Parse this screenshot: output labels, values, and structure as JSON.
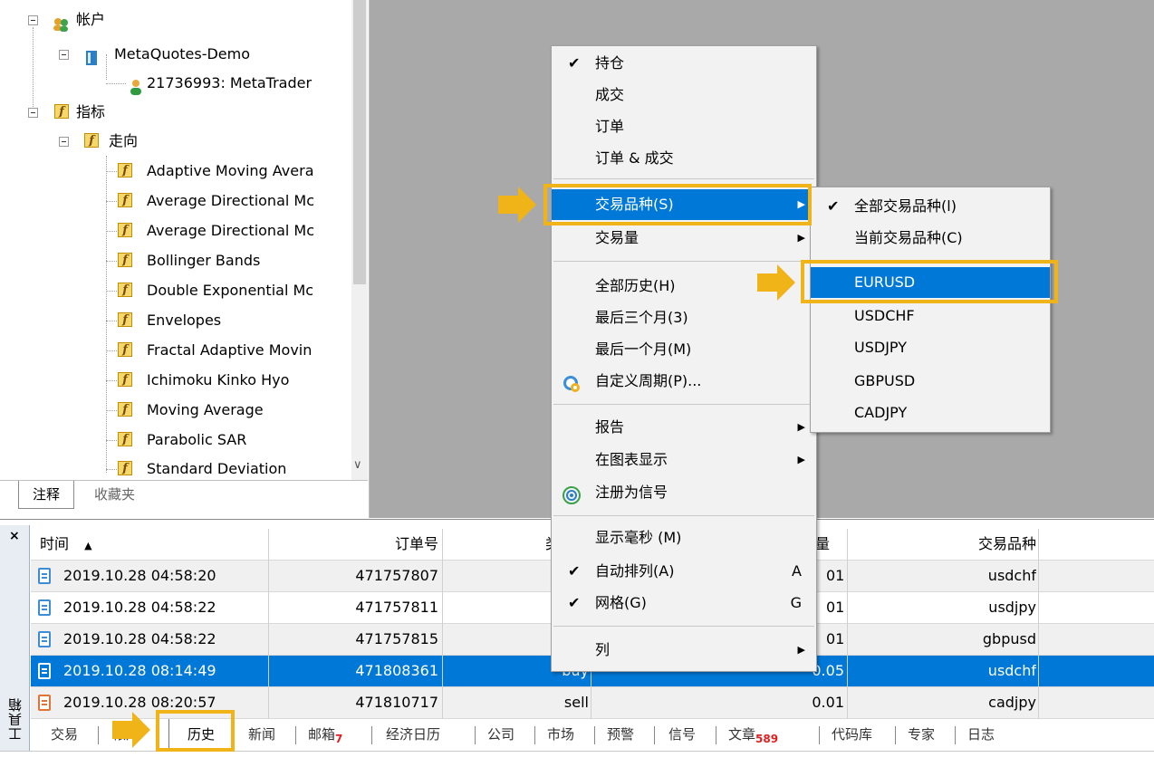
{
  "navigator": {
    "accounts_label": "帐户",
    "server_label": "MetaQuotes-Demo",
    "account_label": "21736993: MetaTrader",
    "indicators_label": "指标",
    "trend_label": "走向",
    "trend_items": [
      "Adaptive Moving Avera",
      "Average Directional Mc",
      "Average Directional Mc",
      "Bollinger Bands",
      "Double Exponential Mc",
      "Envelopes",
      "Fractal Adaptive Movin",
      "Ichimoku Kinko Hyo",
      "Moving Average",
      "Parabolic SAR",
      "Standard Deviation"
    ],
    "tabs": [
      "注释",
      "收藏夹"
    ],
    "scroll_down_glyph": "∨"
  },
  "toolbox": {
    "title": "工具箱",
    "close_glyph": "×",
    "columns": {
      "time": "时间",
      "sort_glyph": "▲",
      "order": "订单号",
      "type_partial": "类",
      "volume_partial": "量",
      "symbol": "交易品种"
    },
    "rows": [
      {
        "time": "2019.10.28 04:58:20",
        "order": "471757807",
        "type": "",
        "volume": "0.01",
        "volume_visible": "01",
        "symbol": "usdchf"
      },
      {
        "time": "2019.10.28 04:58:22",
        "order": "471757811",
        "type": "",
        "volume": "0.01",
        "volume_visible": "01",
        "symbol": "usdjpy"
      },
      {
        "time": "2019.10.28 04:58:22",
        "order": "471757815",
        "type": "",
        "volume": "0.01",
        "volume_visible": "01",
        "symbol": "gbpusd"
      },
      {
        "time": "2019.10.28 08:14:49",
        "order": "471808361",
        "type": "buy",
        "volume": "0.05",
        "volume_visible": "0.05",
        "symbol": "usdchf"
      },
      {
        "time": "2019.10.28 08:20:57",
        "order": "471810717",
        "type": "sell",
        "volume": "0.01",
        "volume_visible": "0.01",
        "symbol": "cadjpy"
      }
    ],
    "tabs": [
      {
        "label": "交易",
        "badge": ""
      },
      {
        "label": "帐户",
        "badge": ""
      },
      {
        "label": "历史",
        "badge": ""
      },
      {
        "label": "新闻",
        "badge": ""
      },
      {
        "label": "邮箱",
        "badge": "7"
      },
      {
        "label": "经济日历",
        "badge": ""
      },
      {
        "label": "公司",
        "badge": ""
      },
      {
        "label": "市场",
        "badge": ""
      },
      {
        "label": "预警",
        "badge": ""
      },
      {
        "label": "信号",
        "badge": ""
      },
      {
        "label": "文章",
        "badge": "589"
      },
      {
        "label": "代码库",
        "badge": ""
      },
      {
        "label": "专家",
        "badge": ""
      },
      {
        "label": "日志",
        "badge": ""
      }
    ]
  },
  "context_menu": {
    "items": [
      {
        "label": "持仓",
        "checked": true
      },
      {
        "label": "成交"
      },
      {
        "label": "订单"
      },
      {
        "label": "订单 & 成交"
      },
      {
        "label": "交易品种(S)",
        "submenu": true,
        "highlighted": true
      },
      {
        "label": "交易量",
        "submenu": true
      },
      {
        "label": "全部历史(H)"
      },
      {
        "label": "最后三个月(3)"
      },
      {
        "label": "最后一个月(M)"
      },
      {
        "label": "自定义周期(P)..."
      },
      {
        "label": "报告",
        "submenu": true
      },
      {
        "label": "在图表显示",
        "submenu": true
      },
      {
        "label": "注册为信号"
      },
      {
        "label": "显示毫秒 (M)"
      },
      {
        "label": "自动排列(A)",
        "checked": true,
        "accel": "A"
      },
      {
        "label": "网格(G)",
        "checked": true,
        "accel": "G"
      },
      {
        "label": "列",
        "submenu": true
      }
    ],
    "check_glyph": "✔",
    "arrow_glyph": "▶"
  },
  "symbol_submenu": {
    "items": [
      {
        "label": "全部交易品种(l)",
        "checked": true
      },
      {
        "label": "当前交易品种(C)"
      },
      {
        "label": "EURUSD",
        "highlighted": true
      },
      {
        "label": "USDCHF"
      },
      {
        "label": "USDJPY"
      },
      {
        "label": "GBPUSD"
      },
      {
        "label": "CADJPY"
      }
    ]
  },
  "colors": {
    "highlight_blue": "#0078d7",
    "annotation_yellow": "#f0b418",
    "gray_area": "#a9a9a9",
    "menu_bg": "#f2f2f2"
  }
}
